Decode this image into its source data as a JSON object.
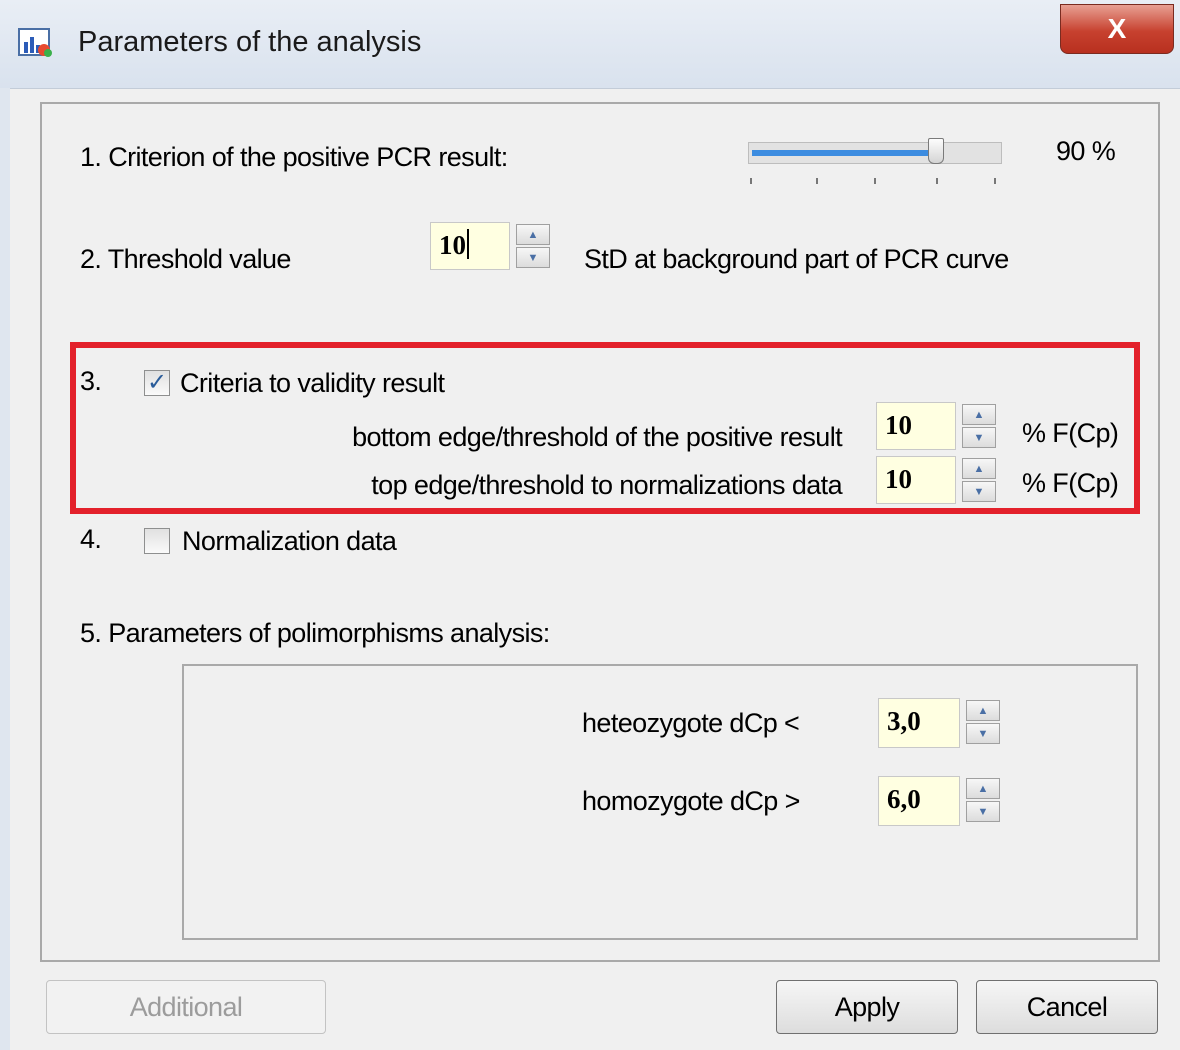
{
  "window": {
    "title": "Parameters of the analysis",
    "close_label": "X"
  },
  "criterion": {
    "label": "1. Criterion of the positive PCR result:",
    "value": 0.9,
    "value_text": "90 %"
  },
  "threshold": {
    "label": "2. Threshold value",
    "value": "10",
    "unit": "StD at background part of PCR curve"
  },
  "validity": {
    "number": "3.",
    "label": "Criteria to validity result",
    "checked": true,
    "bottom": {
      "label": "bottom edge/threshold of the positive result",
      "value": "10",
      "unit": "% F(Cp)"
    },
    "top": {
      "label": "top edge/threshold to normalizations data",
      "value": "10",
      "unit": "% F(Cp)"
    }
  },
  "normalization": {
    "number": "4.",
    "label": "Normalization data",
    "checked": false
  },
  "polymorphisms": {
    "label": "5. Parameters of polimorphisms analysis:",
    "heterozygote": {
      "label": "heteozygote dCp <",
      "value": "3,0"
    },
    "homozygote": {
      "label": "homozygote dCp >",
      "value": "6,0"
    }
  },
  "buttons": {
    "additional": "Additional",
    "apply": "Apply",
    "cancel": "Cancel"
  },
  "colors": {
    "highlight_border": "#e3212b",
    "slider_fill": "#3c8ce0",
    "input_bg": "#ffffe1"
  },
  "icons": {
    "title": "chart-icon",
    "spin_up": "arrow-up-icon",
    "spin_down": "arrow-down-icon",
    "check": "checkmark-icon"
  }
}
